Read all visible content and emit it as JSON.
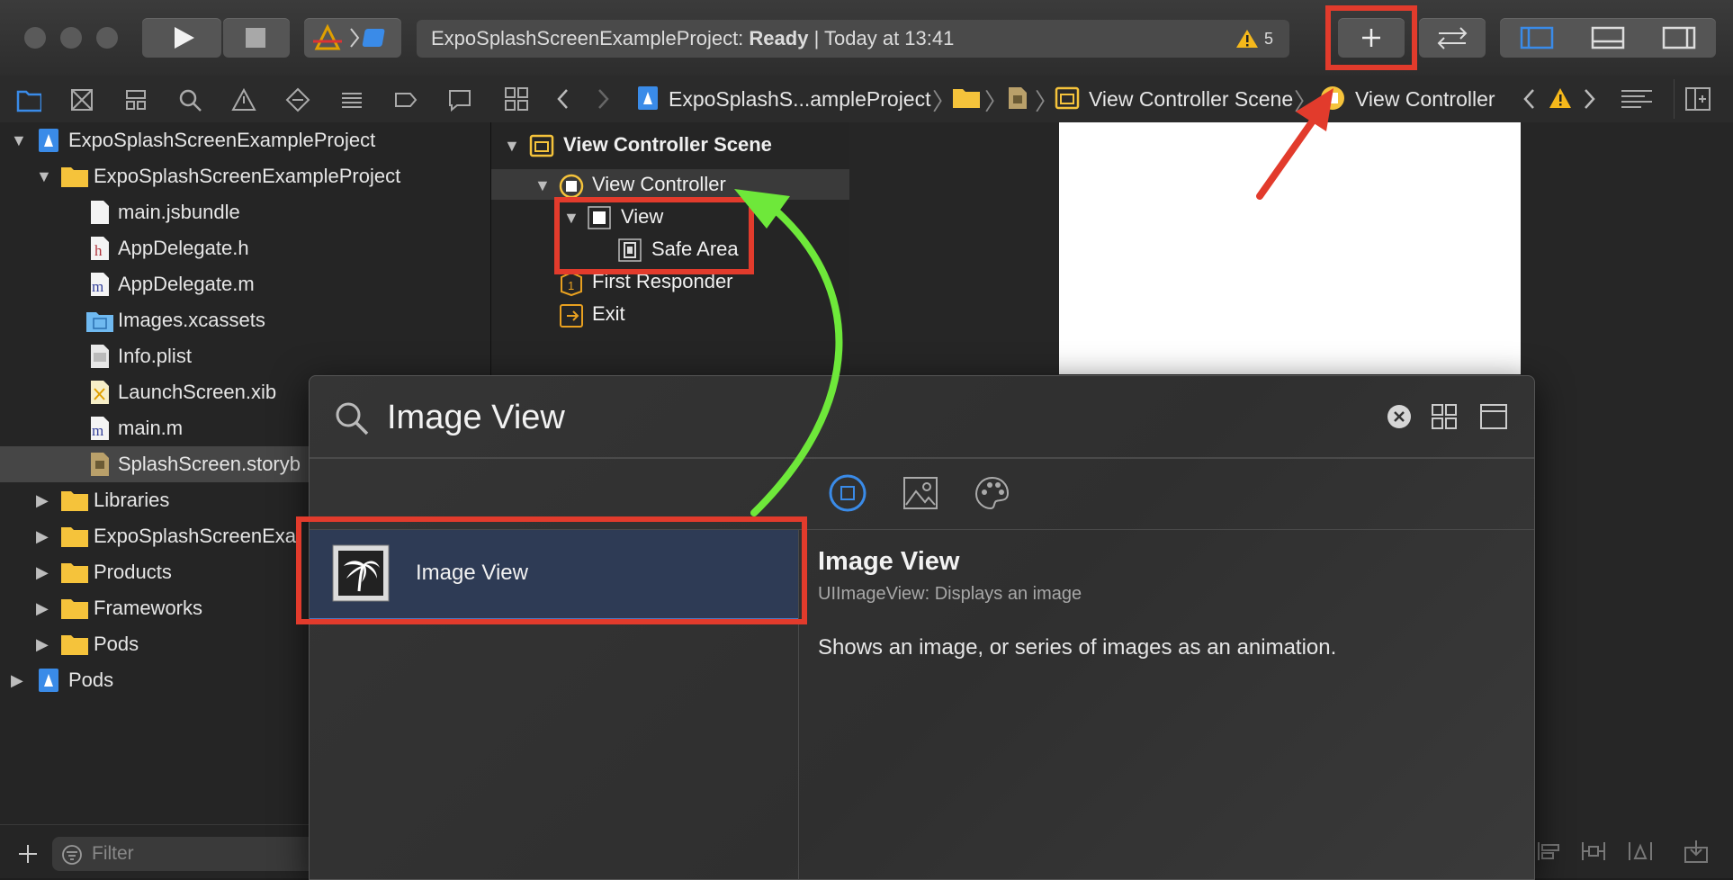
{
  "toolbar": {
    "status_project": "ExpoSplashScreenExampleProject:",
    "status_state": "Ready",
    "status_separator": "|",
    "status_time": "Today at 13:41",
    "warning_count": "5"
  },
  "breadcrumb": {
    "project": "ExpoSplashS...ampleProject",
    "scene": "View Controller Scene",
    "controller": "View Controller"
  },
  "navigator": {
    "items": [
      {
        "label": "ExpoSplashScreenExampleProject",
        "icon": "project-icon"
      },
      {
        "label": "ExpoSplashScreenExampleProject",
        "icon": "folder-icon"
      },
      {
        "label": "main.jsbundle",
        "icon": "file-icon"
      },
      {
        "label": "AppDelegate.h",
        "icon": "h-file-icon"
      },
      {
        "label": "AppDelegate.m",
        "icon": "m-file-icon"
      },
      {
        "label": "Images.xcassets",
        "icon": "asset-catalog-icon"
      },
      {
        "label": "Info.plist",
        "icon": "plist-icon"
      },
      {
        "label": "LaunchScreen.xib",
        "icon": "xib-icon"
      },
      {
        "label": "main.m",
        "icon": "m-file-icon"
      },
      {
        "label": "SplashScreen.storyb",
        "icon": "storyboard-icon"
      },
      {
        "label": "Libraries",
        "icon": "folder-icon"
      },
      {
        "label": "ExpoSplashScreenExa",
        "icon": "folder-icon"
      },
      {
        "label": "Products",
        "icon": "folder-icon"
      },
      {
        "label": "Frameworks",
        "icon": "folder-icon"
      },
      {
        "label": "Pods",
        "icon": "folder-icon"
      },
      {
        "label": "Pods",
        "icon": "project-icon"
      }
    ],
    "filter_placeholder": "Filter"
  },
  "outline": {
    "scene": "View Controller Scene",
    "controller": "View Controller",
    "view": "View",
    "safe_area": "Safe Area",
    "first_responder": "First Responder",
    "exit": "Exit"
  },
  "library": {
    "search_value": "Image View",
    "result_label": "Image View",
    "detail_title": "Image View",
    "detail_subtitle": "UIImageView: Displays an image",
    "detail_description": "Shows an image, or series of images as an animation."
  },
  "colors": {
    "highlight_red": "#e23b2c",
    "arrow_green": "#6ee83a",
    "selection_blue": "#2e3b55"
  }
}
